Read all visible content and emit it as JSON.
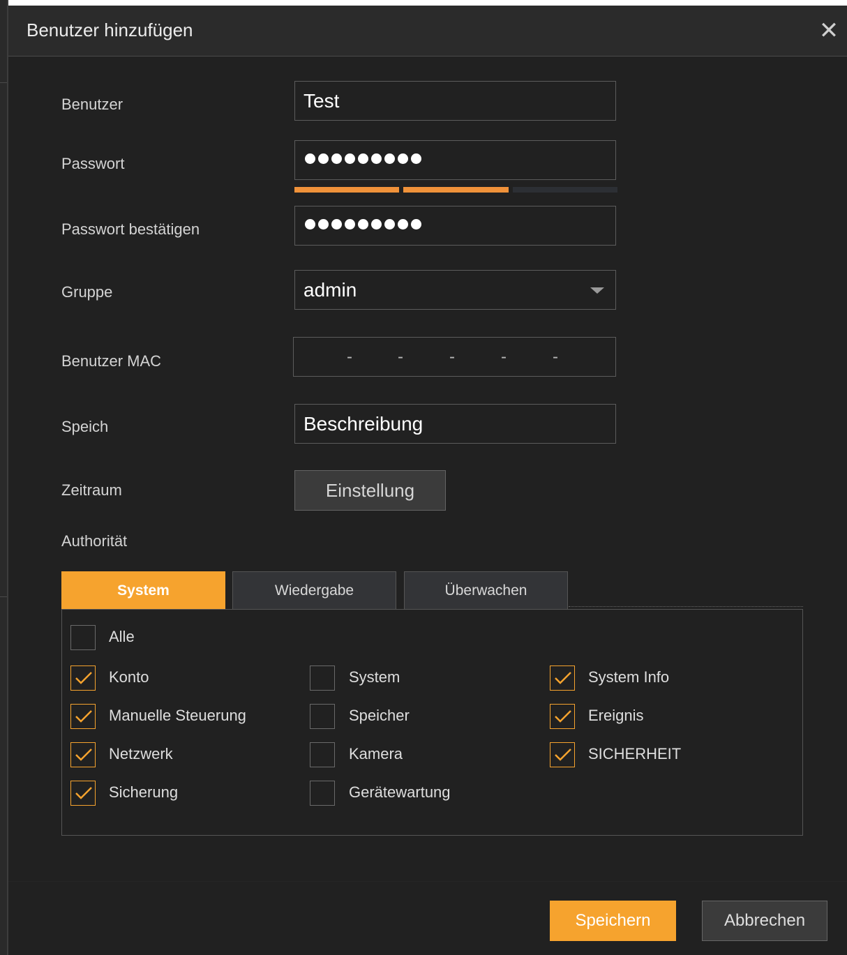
{
  "dialog": {
    "title": "Benutzer hinzufügen",
    "close_icon": "close-icon"
  },
  "form": {
    "user_label": "Benutzer",
    "user_value": "Test",
    "password_label": "Passwort",
    "password_dots": "●●●●●●●●●",
    "password_strength": {
      "filled": 2,
      "total": 3
    },
    "confirm_label": "Passwort bestätigen",
    "confirm_dots": "●●●●●●●●●",
    "group_label": "Gruppe",
    "group_value": "admin",
    "mac_label": "Benutzer MAC",
    "mac_separators": [
      "-",
      "-",
      "-",
      "-",
      "-"
    ],
    "memo_label": "Speich",
    "memo_value": "Beschreibung",
    "period_label": "Zeitraum",
    "period_button": "Einstellung",
    "authority_label": "Authorität"
  },
  "tabs": [
    {
      "label": "System",
      "active": true
    },
    {
      "label": "Wiedergabe",
      "active": false
    },
    {
      "label": "Überwachen",
      "active": false
    }
  ],
  "permissions": {
    "all": {
      "label": "Alle",
      "checked": false
    },
    "items": [
      {
        "label": "Konto",
        "checked": true
      },
      {
        "label": "System",
        "checked": false
      },
      {
        "label": "System Info",
        "checked": true
      },
      {
        "label": "Manuelle Steuerung",
        "checked": true
      },
      {
        "label": "Speicher",
        "checked": false
      },
      {
        "label": "Ereignis",
        "checked": true
      },
      {
        "label": "Netzwerk",
        "checked": true
      },
      {
        "label": "Kamera",
        "checked": false
      },
      {
        "label": "SICHERHEIT",
        "checked": true
      },
      {
        "label": "Sicherung",
        "checked": true
      },
      {
        "label": "Gerätewartung",
        "checked": false
      }
    ]
  },
  "footer": {
    "save_label": "Speichern",
    "cancel_label": "Abbrechen"
  },
  "colors": {
    "accent": "#f6a32e",
    "strength": "#f0923a",
    "background": "#212121"
  }
}
